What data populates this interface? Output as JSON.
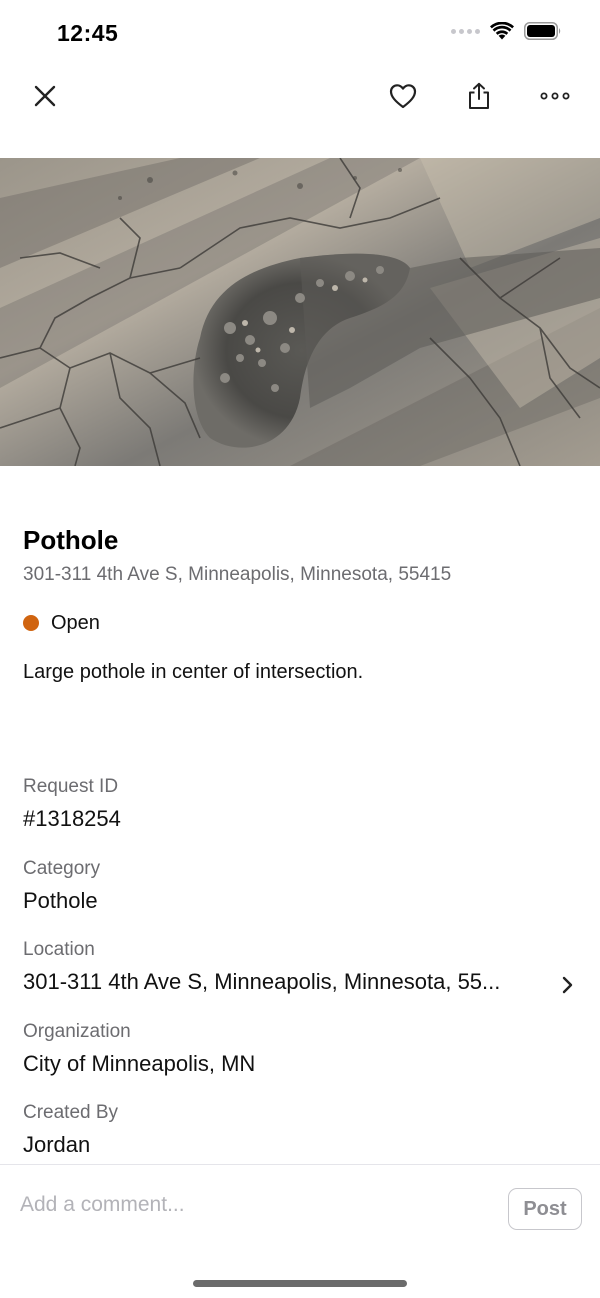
{
  "status_bar": {
    "time": "12:45",
    "icons": [
      "signal-icon",
      "wifi-icon",
      "battery-icon"
    ]
  },
  "nav": {
    "close_icon": "close-icon",
    "favorite_icon": "heart-icon",
    "share_icon": "share-icon",
    "more_icon": "more-icon"
  },
  "report": {
    "title": "Pothole",
    "address": "301-311 4th Ave S, Minneapolis, Minnesota, 55415",
    "status": "Open",
    "status_color": "#d06410",
    "description": "Large pothole in center of intersection."
  },
  "details": [
    {
      "label": "Request ID",
      "value": "#1318254"
    },
    {
      "label": "Category",
      "value": "Pothole"
    },
    {
      "label": "Location",
      "value": "301-311 4th Ave S, Minneapolis, Minnesota, 55..."
    },
    {
      "label": "Organization",
      "value": "City of Minneapolis, MN"
    },
    {
      "label": "Created By",
      "value": "Jordan"
    }
  ],
  "comment": {
    "placeholder": "Add a comment...",
    "post_label": "Post"
  },
  "colors": {
    "accent_status": "#d06410",
    "secondary_text": "#6c6c70"
  }
}
